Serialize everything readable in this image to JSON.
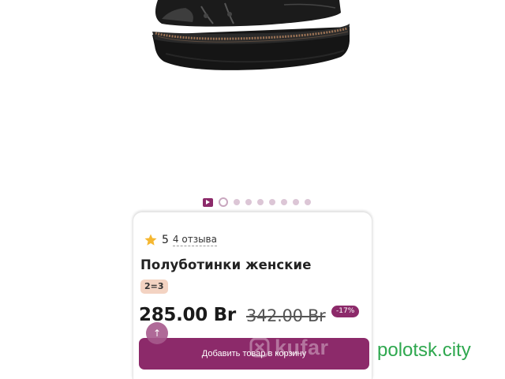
{
  "product": {
    "rating_value": "5",
    "reviews_label": "4 отзыва",
    "title": "Полуботинки женские",
    "promo_badge": "2=3",
    "price": "285.00 Br",
    "old_price": "342.00 Br",
    "discount": "-17%"
  },
  "gallery": {
    "current_slide_index": 1,
    "slide_count": 9
  },
  "actions": {
    "add_to_cart_label": "Добавить товар в корзину",
    "scroll_up_icon": "arrow-up-icon"
  },
  "overlays": {
    "watermark_text": "kufar",
    "site_label": "polotsk.city"
  },
  "colors": {
    "accent": "#8c2a6a",
    "promo_badge_bg": "#f3d3c2",
    "site_label": "#2fa84f",
    "star": "#f5b731"
  }
}
